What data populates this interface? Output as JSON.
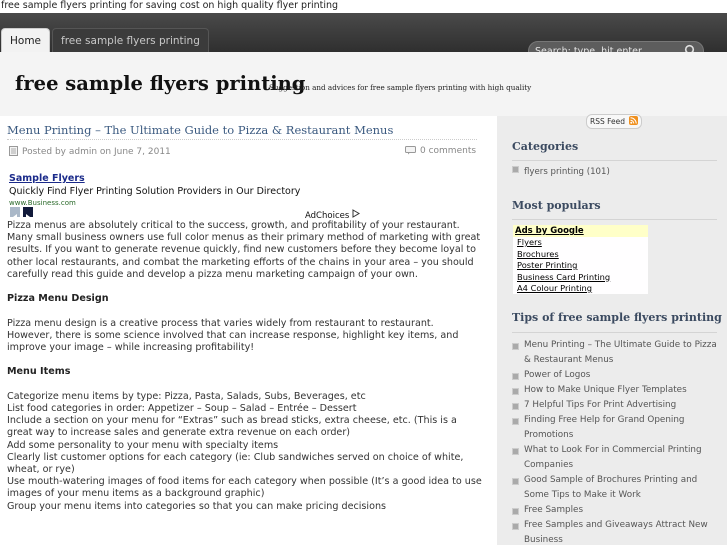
{
  "browser": {
    "title_line": "free sample flyers printing for saving cost on high quality flyer printing"
  },
  "nav": {
    "tabs": [
      {
        "label": "Home"
      },
      {
        "label": "free sample flyers printing"
      }
    ],
    "search_placeholder": "Search: type, hit enter"
  },
  "header": {
    "site_title": "free sample flyers printing",
    "site_description": "Suggestion and advices for free sample flyers printing with high quality"
  },
  "post": {
    "title": "Menu Printing – The Ultimate Guide to Pizza & Restaurant Menus",
    "meta_posted": "Posted by admin on June 7, 2011",
    "meta_comments": "0 comments",
    "ad": {
      "title": "Sample Flyers",
      "text": "Quickly Find Flyer Printing Solution Providers in Our Directory",
      "url": "www.Business.com",
      "adchoices": "AdChoices"
    },
    "intro": "Pizza menus are absolutely critical to the success, growth, and profitability of your restaurant. Many small business owners use full color menus as their primary method of marketing with great results. If you want to generate revenue quickly, find new customers before they become loyal to other local restaurants, and combat the marketing efforts of the chains in your area – you should carefully read this guide and develop a pizza menu marketing campaign of your own.",
    "section1_heading": "Pizza Menu Design",
    "section1_text": "Pizza menu design is a creative process that varies widely from restaurant to restaurant. However, there is some science involved that can increase response, highlight key items, and improve your image – while increasing profitability!",
    "section2_heading": "Menu Items",
    "section2_lines": [
      "Categorize menu items by type: Pizza, Pasta, Salads, Subs, Beverages, etc",
      "List food categories in order: Appetizer – Soup – Salad – Entrée – Dessert",
      "Include a section on your menu for “Extras” such as bread sticks, extra cheese, etc. (This is a great way to increase sales and generate extra revenue on each order)",
      "Add some personality to your menu with specialty items",
      "Clearly list customer options for each category (ie: Club sandwiches served on choice of white, wheat, or rye)",
      "Use mouth-watering images of food items for each category when possible (It’s a good idea to use images of your menu items as a background graphic)",
      "Group your menu items into categories so that you can make pricing decisions"
    ]
  },
  "sidebar": {
    "rss_label": "RSS Feed",
    "categories_heading": "Categories",
    "categories": [
      {
        "label": "flyers printing (101)"
      }
    ],
    "popular_heading": "Most populars",
    "google_ads": {
      "header": "Ads by Google",
      "links": [
        "Flyers",
        "Brochures",
        "Poster Printing",
        "Business Card Printing",
        "A4 Colour Printing"
      ]
    },
    "tips_heading": "Tips of free sample flyers printing",
    "tips": [
      "Menu Printing – The Ultimate Guide to Pizza & Restaurant Menus",
      "Power of Logos",
      "How to Make Unique Flyer Templates",
      "7 Helpful Tips For Print Advertising",
      "Finding Free Help for Grand Opening Promotions",
      "What to Look For in Commercial Printing Companies",
      "Good Sample of Brochures Printing and Some Tips to Make it Work",
      "Free Samples",
      "Free Samples and Giveaways Attract New Business"
    ]
  },
  "colors": {
    "nav_bg": "#3a3a3a",
    "post_title": "#3b5a80",
    "sidebar_bg": "#ececec",
    "rss_orange": "#f0901e"
  },
  "icons": [
    "search-icon",
    "document-icon",
    "comment-bubble-icon",
    "rss-icon",
    "arrow-left-icon",
    "arrow-right-icon",
    "adchoices-icon"
  ]
}
